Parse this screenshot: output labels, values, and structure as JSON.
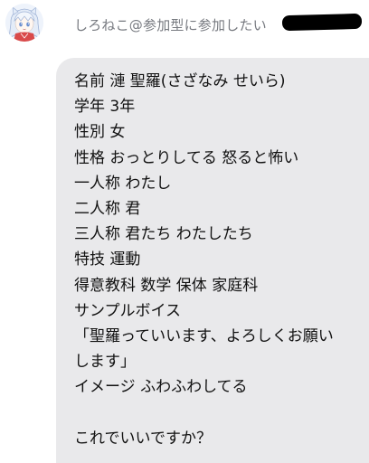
{
  "sender": {
    "name": "しろねこ@参加型に参加したい"
  },
  "message": {
    "lines": [
      "名前 漣 聖羅(さざなみ せいら)",
      "学年 3年",
      "性別 女",
      "性格 おっとりしてる 怒ると怖い",
      "一人称 わたし",
      "二人称 君",
      "三人称 君たち わたしたち",
      "特技 運動",
      "得意教科 数学 保体 家庭科",
      "サンプルボイス",
      "「聖羅っていいます、よろしくお願い",
      "します」",
      "イメージ ふわふわしてる",
      "",
      "これでいいですか？"
    ]
  },
  "colors": {
    "bubble": "#e9e9eb",
    "sender_text": "#777a80",
    "message_text": "#111111",
    "redaction": "#000000"
  },
  "icons": {
    "avatar": "anime-girl-avatar-icon"
  }
}
